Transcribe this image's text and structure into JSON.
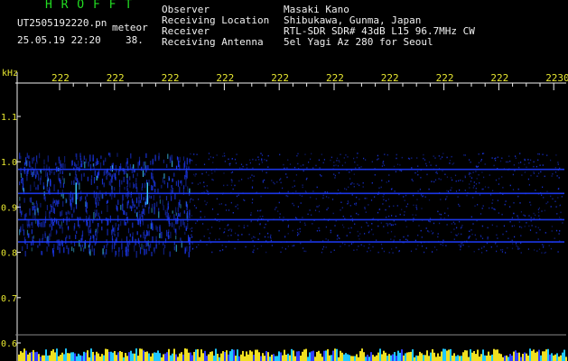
{
  "header": {
    "app_title": "H R O F F T",
    "filename": "UT2505192220.pn",
    "mode": "meteor",
    "datetime": "25.05.19 22:20",
    "count": "38.",
    "fields": [
      {
        "label": "Observer",
        "value": "Masaki Kano"
      },
      {
        "label": "Receiving Location",
        "value": "Shibukawa, Gunma, Japan"
      },
      {
        "label": "Receiver",
        "value": "RTL-SDR SDR# 43dB L15 96.7MHz CW"
      },
      {
        "label": "Receiving Antenna",
        "value": "5el Yagi Az 280 for Seoul"
      }
    ]
  },
  "colors": {
    "background": "#000000",
    "title": "#22dd22",
    "text": "#f0f0f0",
    "axis": "#e8e830",
    "signal": "#1e3cff",
    "signal_bright": "#40d0ff"
  },
  "chart_data": {
    "type": "heatmap",
    "title": "",
    "xlabel": "",
    "ylabel": "kHz",
    "x_ticks": [
      "222",
      "222",
      "222",
      "222",
      "222",
      "222",
      "222",
      "222",
      "222",
      "2230"
    ],
    "y_ticks": [
      "1.1",
      "1.0",
      "0.9",
      "0.8",
      "0.7",
      "0.6"
    ],
    "ylim": [
      0.6,
      1.1
    ],
    "noise_band_khz": [
      0.8,
      1.02
    ],
    "carrier_lines_khz": [
      0.983,
      0.93,
      0.872,
      0.823
    ],
    "meteor_echoes": [
      {
        "x_minute": 0.3,
        "freq_khz": 0.93
      },
      {
        "x_minute": 1.6,
        "freq_khz": 0.93
      },
      {
        "x_minute": 9.4,
        "freq_khz": 0.93
      }
    ]
  }
}
